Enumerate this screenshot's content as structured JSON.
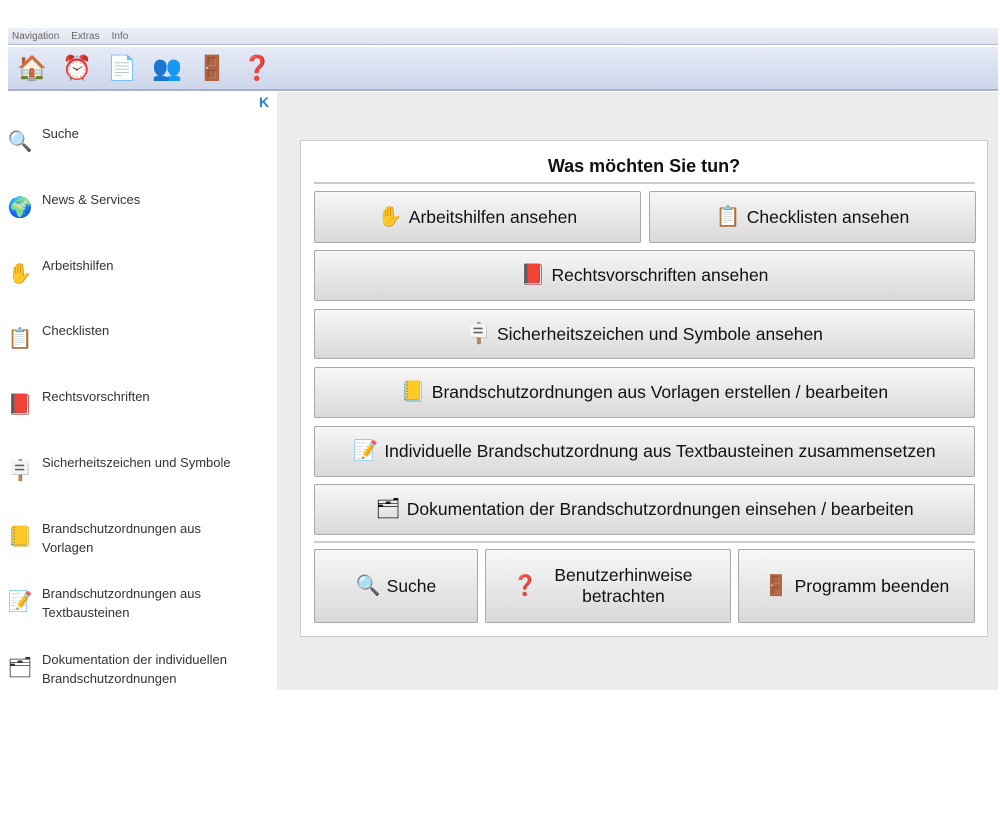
{
  "menu": [
    "Navigation",
    "Extras",
    "Info"
  ],
  "toolbar": [
    {
      "name": "home-icon",
      "glyph": "🏠"
    },
    {
      "name": "alarm-clock-icon",
      "glyph": "⏰"
    },
    {
      "name": "search-document-icon",
      "glyph": "📄"
    },
    {
      "name": "users-icon",
      "glyph": "👥"
    },
    {
      "name": "exit-door-icon",
      "glyph": "🚪"
    },
    {
      "name": "help-icon",
      "glyph": "❓"
    }
  ],
  "collapse": "K",
  "sidebar": [
    {
      "label": "Suche",
      "glyph": "🔍"
    },
    {
      "label": "News & Services",
      "glyph": "🌍"
    },
    {
      "label": "Arbeitshilfen",
      "glyph": "✋"
    },
    {
      "label": "Checklisten",
      "glyph": "📋"
    },
    {
      "label": "Rechtsvorschriften",
      "glyph": "📕"
    },
    {
      "label": "Sicherheitszeichen und Symbole",
      "glyph": "🪧"
    },
    {
      "label": "Brandschutzordnungen aus Vorlagen",
      "glyph": "📒"
    },
    {
      "label": "Brandschutzordnungen aus Textbausteinen",
      "glyph": "📝"
    },
    {
      "label": "Dokumentation der individuellen Brandschutzordnungen",
      "glyph": "🗂"
    }
  ],
  "main": {
    "title": "Was möchten Sie tun?",
    "buttons": [
      {
        "label": "Arbeitshilfen ansehen",
        "glyph": "✋"
      },
      {
        "label": "Checklisten ansehen",
        "glyph": "📋"
      },
      {
        "label": "Rechtsvorschriften ansehen",
        "glyph": "📕"
      },
      {
        "label": "Sicherheitszeichen und Symbole ansehen",
        "glyph": "🪧"
      },
      {
        "label": "Brandschutzordnungen aus Vorlagen erstellen / bearbeiten",
        "glyph": "📒"
      },
      {
        "label": "Individuelle Brandschutzordnung aus Textbausteinen zusammensetzen",
        "glyph": "📝"
      },
      {
        "label": "Dokumentation der Brandschutzordnungen einsehen / bearbeiten",
        "glyph": "🗂"
      },
      {
        "label": "Suche",
        "glyph": "🔍"
      },
      {
        "label": "Benutzerhinweise betrachten",
        "glyph": "❓"
      },
      {
        "label": "Programm beenden",
        "glyph": "🚪"
      }
    ]
  }
}
